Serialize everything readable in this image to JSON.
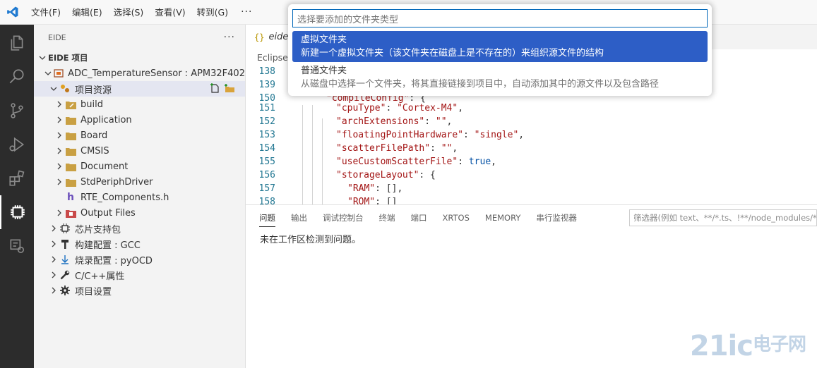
{
  "menu": [
    "文件(F)",
    "编辑(E)",
    "选择(S)",
    "查看(V)",
    "转到(G)"
  ],
  "menu_more": "···",
  "sidebar": {
    "header": "EIDE",
    "header_more": "···",
    "section": "EIDE 项目",
    "project": "ADC_TemperatureSensor : APM32F402",
    "resources": "项目资源",
    "folders": [
      "build",
      "Application",
      "Board",
      "CMSIS",
      "Document",
      "StdPeriphDriver",
      "RTE_Components.h",
      "Output Files"
    ],
    "groups": [
      "芯片支持包",
      "构建配置 : GCC",
      "烧录配置 : pyOCD",
      "C/C++属性",
      "项目设置"
    ]
  },
  "editor": {
    "tab_braces": "{}",
    "tab_label": "eide.j",
    "breadcrumb": "Eclipse",
    "lines": [
      {
        "n": "138",
        "code": ""
      },
      {
        "n": "139",
        "code": ""
      },
      {
        "n": "150",
        "key": "\"compileConfig\"",
        "rest": ": {"
      },
      {
        "n": "151",
        "key": "\"cpuType\"",
        "rest": ": ",
        "val": "\"Cortex-M4\"",
        "end": ","
      },
      {
        "n": "152",
        "key": "\"archExtensions\"",
        "rest": ": ",
        "val": "\"\"",
        "end": ","
      },
      {
        "n": "153",
        "key": "\"floatingPointHardware\"",
        "rest": ": ",
        "val": "\"single\"",
        "end": ","
      },
      {
        "n": "154",
        "key": "\"scatterFilePath\"",
        "rest": ": ",
        "val": "\"\"",
        "end": ","
      },
      {
        "n": "155",
        "key": "\"useCustomScatterFile\"",
        "rest": ": ",
        "val": "true",
        "end": ","
      },
      {
        "n": "156",
        "key": "\"storageLayout\"",
        "rest": ": {"
      },
      {
        "n": "157",
        "key": "\"RAM\"",
        "rest": ": [],"
      },
      {
        "n": "158",
        "key": "\"ROM\"",
        "rest": ": []"
      }
    ]
  },
  "panel": {
    "tabs": [
      "问题",
      "输出",
      "调试控制台",
      "终端",
      "端口",
      "XRTOS",
      "MEMORY",
      "串行监视器"
    ],
    "filter_placeholder": "筛选器(例如 text、**/*.ts、!**/node_modules/**)",
    "message": "未在工作区检测到问题。"
  },
  "quickpick": {
    "placeholder": "选择要添加的文件夹类型",
    "items": [
      {
        "title": "虚拟文件夹",
        "desc": "新建一个虚拟文件夹（该文件夹在磁盘上是不存在的）来组织源文件的结构"
      },
      {
        "title": "普通文件夹",
        "desc": "从磁盘中选择一个文件夹，将其直接链接到项目中，自动添加其中的源文件以及包含路径"
      }
    ]
  },
  "watermark": {
    "main": "21ic",
    "sub": "电子网"
  },
  "colors": {
    "activitybar": "#2c2c2c",
    "selection": "#2d5ec6",
    "accent": "#0066b8"
  }
}
